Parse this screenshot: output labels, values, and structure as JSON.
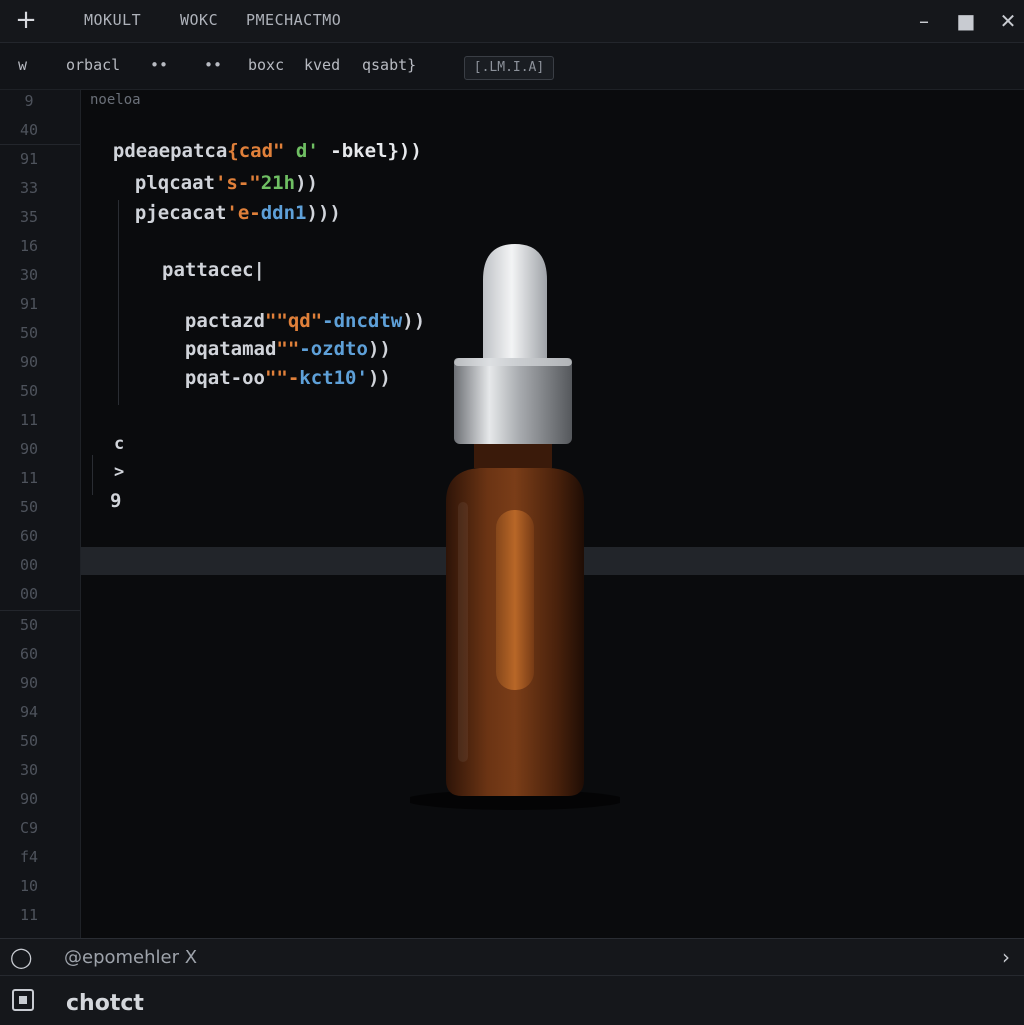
{
  "titlebar": {
    "menu": [
      "MOKULT",
      "WOKC",
      "PMECHACTMO"
    ],
    "new_icon": "plus-icon",
    "minimize_icon": "minimize-icon",
    "maximize_icon": "maximize-icon",
    "close_icon": "close-icon"
  },
  "toolbar": {
    "items": [
      "w",
      "orbacl",
      "••",
      "••",
      "boxc",
      "kved",
      "qsabt}"
    ],
    "badge": "[.LM.I.A]"
  },
  "gutter": {
    "line_numbers": [
      "9",
      "40",
      "91",
      "33",
      "35",
      "16",
      "30",
      "91",
      "50",
      "90",
      "50",
      "11",
      "90",
      "11",
      "50",
      "60",
      "00",
      "00",
      "50",
      "60",
      "90",
      "94",
      "50",
      "30",
      "90",
      "C9",
      "f4",
      "10",
      "11"
    ]
  },
  "editor": {
    "lines": [
      {
        "text": "noeloa"
      },
      {
        "a": "pdeaepatca",
        "b": "{cad\"",
        "c": " d' ",
        "d": "-bkel}))"
      },
      {
        "a": "plqcaat",
        "b": "'s-\"",
        "c": "21h",
        "d": "))"
      },
      {
        "a": "pjecacat",
        "b": "'e-",
        "c": "ddn1",
        "d": ")))"
      },
      {
        "text": "pattacec|"
      },
      {
        "a": "pactazd",
        "b": "\"\"qd\"",
        "c": "-dncdtw",
        "d": "))"
      },
      {
        "a": "pqatamad",
        "b": "\"\"",
        "c": "-ozdto",
        "d": "))"
      },
      {
        "a": "pqat-oo",
        "b": "\"\"-",
        "c": "kct10'",
        "d": "))"
      },
      {
        "text": "c"
      },
      {
        "text": ">"
      },
      {
        "text": "9"
      }
    ]
  },
  "bottom_panel": {
    "circle_icon": "circle-icon",
    "tab_label": "@epomehler X",
    "chevron_icon": "chevron-right-icon",
    "square_icon": "terminal-icon",
    "terminal_text": "chotct"
  },
  "colors": {
    "background": "#0a0b0d",
    "orange": "#e0803a",
    "green": "#6fbf63",
    "blue": "#5ea0d8",
    "bottle_amber": "#5a2b12",
    "cap_silver": "#c9cbce"
  }
}
